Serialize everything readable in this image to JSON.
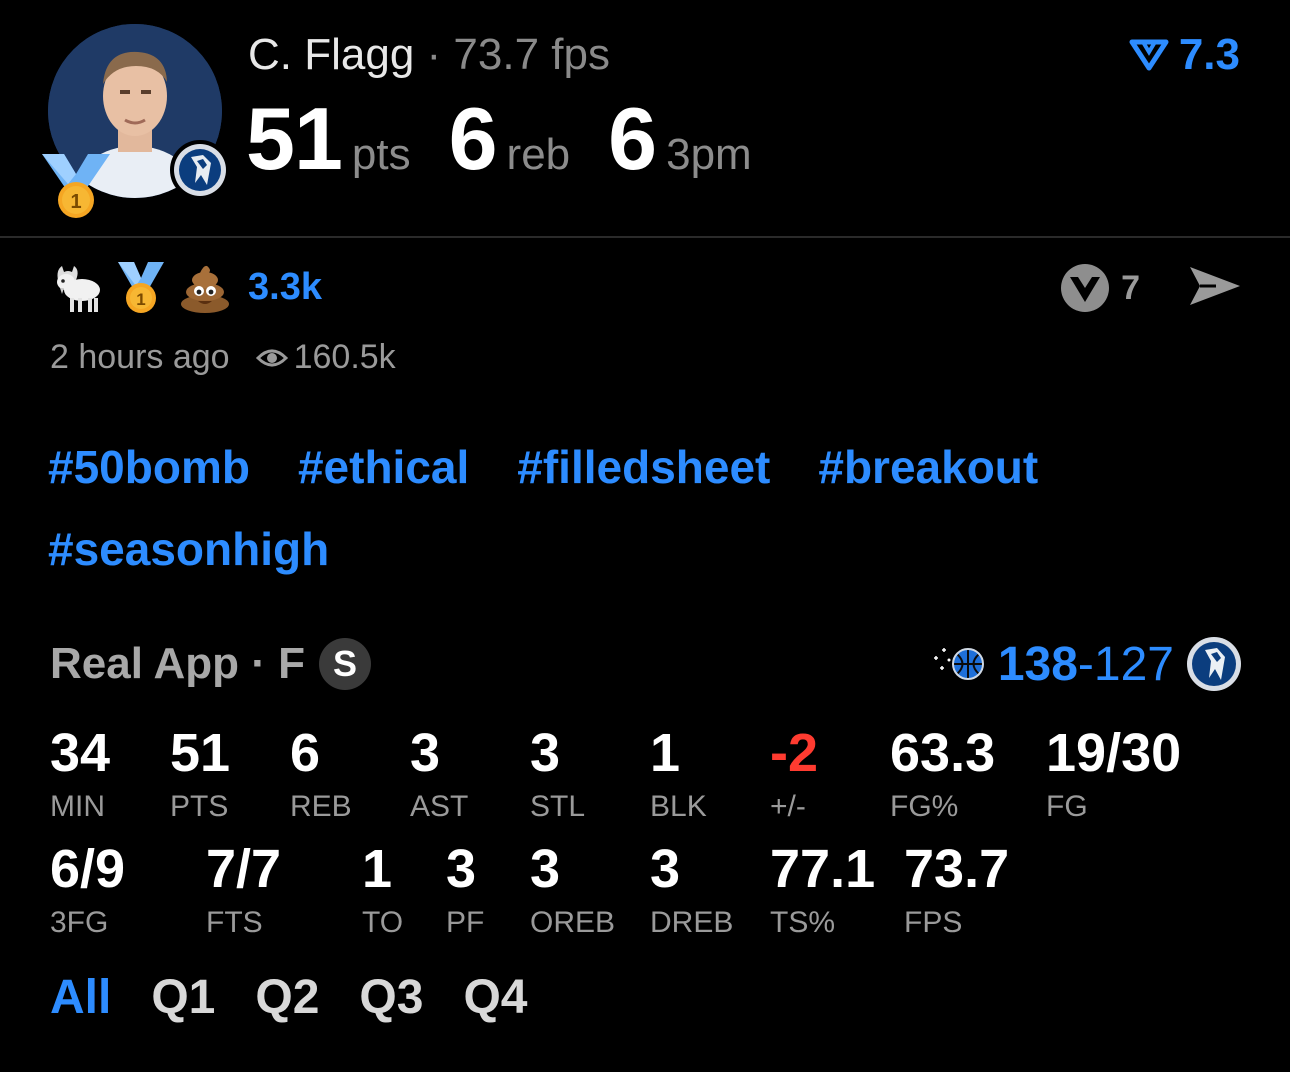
{
  "header": {
    "player_name": "C. Flagg",
    "separator": "·",
    "fps_text": "73.7 fps",
    "rating_value": "7.3",
    "medal_number": "1",
    "headline": [
      {
        "value": "51",
        "unit": "pts"
      },
      {
        "value": "6",
        "unit": "reb"
      },
      {
        "value": "6",
        "unit": "3pm"
      }
    ]
  },
  "reactions": {
    "icons": [
      "goat-icon",
      "medal-icon",
      "poop-icon"
    ],
    "medal_number": "1",
    "count": "3.3k",
    "vote_count": "7"
  },
  "meta": {
    "time_ago": "2 hours ago",
    "views": "160.5k"
  },
  "hashtags": [
    "#50bomb",
    "#ethical",
    "#filledsheet",
    "#breakout",
    "#seasonhigh"
  ],
  "game": {
    "source": "Real App · F",
    "badge": "S",
    "score_home": "138",
    "score_dash": "-",
    "score_away": "127"
  },
  "stats_row1": [
    {
      "value": "34",
      "label": "MIN"
    },
    {
      "value": "51",
      "label": "PTS"
    },
    {
      "value": "6",
      "label": "REB"
    },
    {
      "value": "3",
      "label": "AST"
    },
    {
      "value": "3",
      "label": "STL"
    },
    {
      "value": "1",
      "label": "BLK"
    },
    {
      "value": "-2",
      "label": "+/-"
    },
    {
      "value": "63.3",
      "label": "FG%"
    },
    {
      "value": "19/30",
      "label": "FG"
    }
  ],
  "stats_row2": [
    {
      "value": "6/9",
      "label": "3FG"
    },
    {
      "value": "7/7",
      "label": "FTS"
    },
    {
      "value": "1",
      "label": "TO"
    },
    {
      "value": "3",
      "label": "PF"
    },
    {
      "value": "3",
      "label": "OREB"
    },
    {
      "value": "3",
      "label": "DREB"
    },
    {
      "value": "77.1",
      "label": "TS%"
    },
    {
      "value": "73.7",
      "label": "FPS"
    }
  ],
  "tabs": [
    "All",
    "Q1",
    "Q2",
    "Q3",
    "Q4"
  ],
  "colors": {
    "accent": "#2d8cff",
    "negative": "#ff3b30",
    "muted": "#9a9a9a",
    "background": "#000000"
  }
}
